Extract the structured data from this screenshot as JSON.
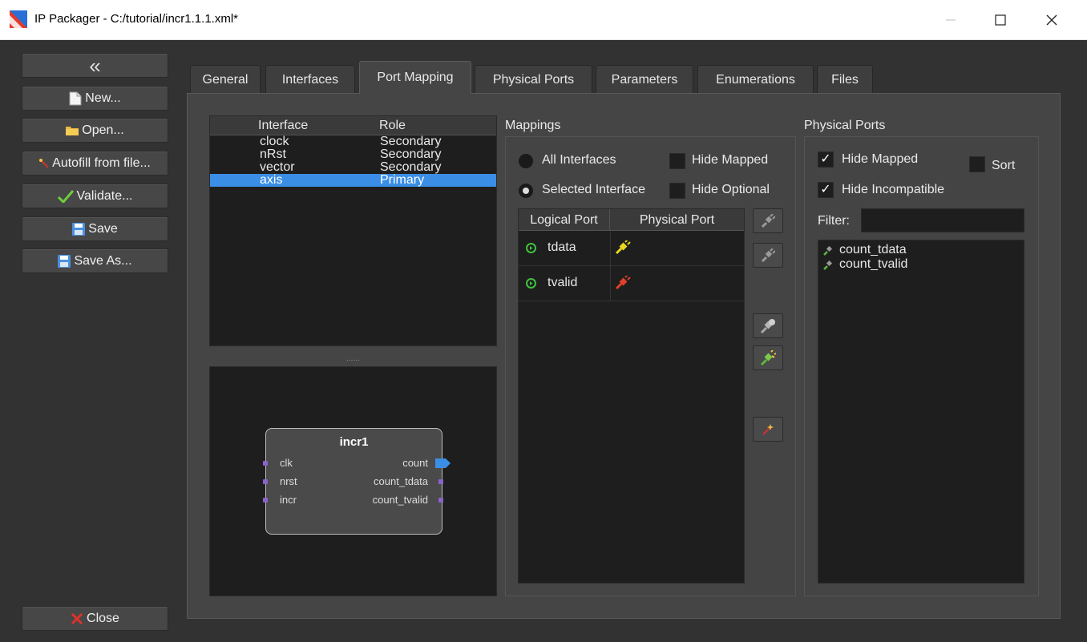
{
  "window": {
    "title": "IP Packager - C:/tutorial/incr1.1.1.xml*",
    "minimize_icon": "minimize-icon",
    "maximize_icon": "maximize-icon",
    "close_icon": "close-icon"
  },
  "sidebar": {
    "collapse_label": "«",
    "buttons": [
      {
        "label": "New...",
        "icon": "new-file-icon"
      },
      {
        "label": "Open...",
        "icon": "folder-icon"
      },
      {
        "label": "Autofill from file...",
        "icon": "wand-icon"
      },
      {
        "label": "Validate...",
        "icon": "checkmark-icon"
      },
      {
        "label": "Save",
        "icon": "floppy-icon"
      },
      {
        "label": "Save As...",
        "icon": "floppy-icon"
      }
    ],
    "close_label": "Close"
  },
  "tabs": [
    "General",
    "Interfaces",
    "Port Mapping",
    "Physical Ports",
    "Parameters",
    "Enumerations",
    "Files"
  ],
  "active_tab": "Port Mapping",
  "interfaces": {
    "headers": {
      "interface": "Interface",
      "role": "Role"
    },
    "rows": [
      {
        "interface": "clock",
        "role": "Secondary"
      },
      {
        "interface": "nRst",
        "role": "Secondary"
      },
      {
        "interface": "vector",
        "role": "Secondary"
      },
      {
        "interface": "axis",
        "role": "Primary"
      }
    ],
    "selected": "axis"
  },
  "splitter_label": "......",
  "block": {
    "name": "incr1",
    "left_ports": [
      "clk",
      "nrst",
      "incr"
    ],
    "right_ports": [
      "count",
      "count_tdata",
      "count_tvalid"
    ]
  },
  "mappings": {
    "title": "Mappings",
    "all_interfaces": "All Interfaces",
    "selected_interface": "Selected Interface",
    "hide_mapped": "Hide Mapped",
    "hide_optional": "Hide Optional",
    "headers": {
      "logical": "Logical Port",
      "physical": "Physical Port"
    },
    "rows": [
      {
        "logical": "tdata",
        "physical": "",
        "status": "mapped-yellow"
      },
      {
        "logical": "tvalid",
        "physical": "",
        "status": "mapped-red"
      }
    ]
  },
  "physical_ports": {
    "title": "Physical Ports",
    "hide_mapped": "Hide Mapped",
    "hide_incompatible": "Hide Incompatible",
    "sort": "Sort",
    "filter_label": "Filter:",
    "filter_value": "",
    "items": [
      "count_tdata",
      "count_tvalid"
    ]
  },
  "colors": {
    "selection": "#3a8ee6",
    "background": "#323232",
    "panel": "#454545",
    "list": "#1e1e1e"
  }
}
